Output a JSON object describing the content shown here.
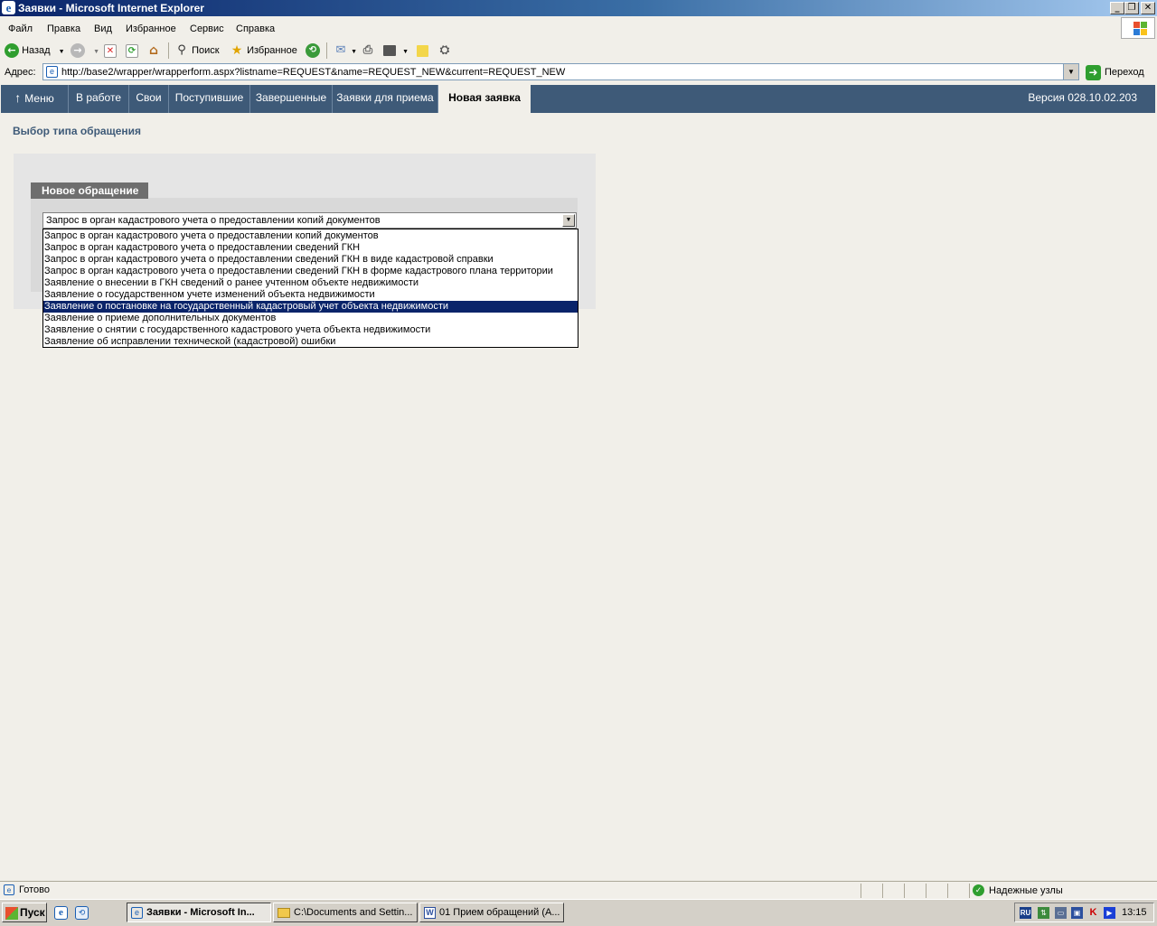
{
  "window": {
    "title": "Заявки - Microsoft Internet Explorer",
    "minimize": "0",
    "restore": "1",
    "close": "r"
  },
  "menu": [
    "Файл",
    "Правка",
    "Вид",
    "Избранное",
    "Сервис",
    "Справка"
  ],
  "toolbar": {
    "back": "Назад",
    "search": "Поиск",
    "favorites": "Избранное"
  },
  "address": {
    "label": "Адрес:",
    "url": "http://base2/wrapper/wrapperform.aspx?listname=REQUEST&name=REQUEST_NEW&current=REQUEST_NEW",
    "go": "Переход"
  },
  "appnav": {
    "tabs": [
      "Меню",
      "В работе",
      "Свои",
      "Поступившие",
      "Завершенные",
      "Заявки для приема",
      "Новая заявка"
    ],
    "active_index": 6,
    "version": "Версия 028.10.02.203"
  },
  "content": {
    "page_title": "Выбор типа обращения",
    "group_title": "Новое обращение",
    "selected_value": "Запрос в орган кадастрового учета о предоставлении копий документов",
    "options": [
      "Запрос в орган кадастрового учета о предоставлении копий документов",
      "Запрос в орган кадастрового учета о предоставлении сведений ГКН",
      "Запрос в орган кадастрового учета о предоставлении сведений ГКН в виде кадастровой справки",
      "Запрос в орган кадастрового учета о предоставлении сведений ГКН в форме кадастрового плана территории",
      "Заявление о внесении в ГКН сведений о ранее учтенном объекте недвижимости",
      "Заявление о государственном учете изменений объекта недвижимости",
      "Заявление о постановке на государственный кадастровый учет объекта недвижимости",
      "Заявление о приеме дополнительных документов",
      "Заявление о снятии с государственного кадастрового учета объекта недвижимости",
      "Заявление об исправлении технической (кадастровой) ошибки"
    ],
    "highlighted_index": 6
  },
  "status": {
    "text": "Готово",
    "zone": "Надежные узлы"
  },
  "taskbar": {
    "start": "Пуск",
    "tasks": [
      "Заявки - Microsoft In...",
      "C:\\Documents and Settin...",
      "01 Прием обращений (А..."
    ],
    "active_index": 0,
    "lang": "RU",
    "clock": "13:15"
  },
  "colors": {
    "nav_bg": "#3e5a78",
    "title_accent": "#3e5a78",
    "selection": "#0a246a"
  }
}
